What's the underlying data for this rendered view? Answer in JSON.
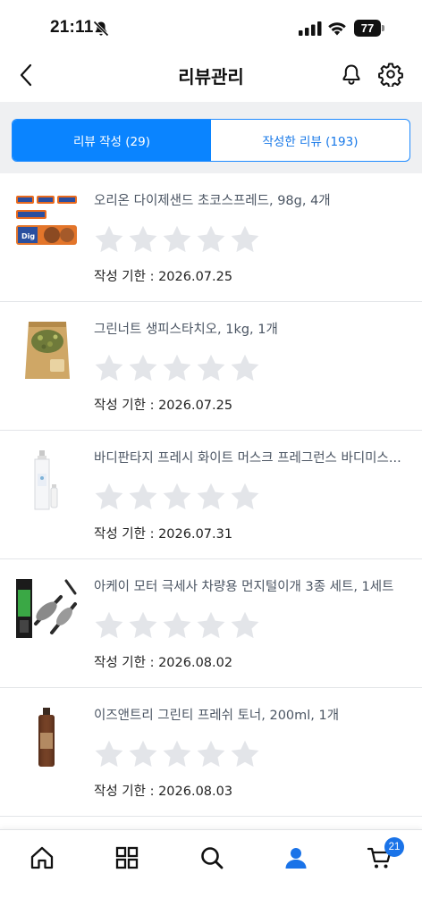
{
  "status_bar": {
    "time": "21:11",
    "battery": "77"
  },
  "header": {
    "title": "리뷰관리",
    "icons": [
      "back-arrow-icon",
      "bell-icon",
      "gear-icon"
    ]
  },
  "tabs": [
    {
      "label": "리뷰 작성 (29)",
      "active": true
    },
    {
      "label": "작성한 리뷰 (193)",
      "active": false
    }
  ],
  "items": [
    {
      "name": "오리온 다이제샌드 초코스프레드, 98g, 4개",
      "deadline": "작성 기한 : 2026.07.25",
      "rating": 0
    },
    {
      "name": "그린너트 생피스타치오, 1kg, 1개",
      "deadline": "작성 기한 : 2026.07.25",
      "rating": 0
    },
    {
      "name": "바디판타지 프레시 화이트 머스크 프레그런스 바디미스...",
      "deadline": "작성 기한 : 2026.07.31",
      "rating": 0
    },
    {
      "name": "아케이 모터 극세사 차량용 먼지털이개 3종 세트, 1세트",
      "deadline": "작성 기한 : 2026.08.02",
      "rating": 0
    },
    {
      "name": "이즈앤트리 그린티 프레쉬 토너, 200ml, 1개",
      "deadline": "작성 기한 : 2026.08.03",
      "rating": 0
    }
  ],
  "bottom_nav": {
    "items": [
      "home-icon",
      "grid-icon",
      "search-icon",
      "user-icon",
      "cart-icon"
    ],
    "active": "user-icon",
    "cart_badge": "21"
  },
  "colors": {
    "accent": "#0a84ff",
    "star_empty": "#e3e5e9",
    "tab_band": "#eff0f2"
  }
}
